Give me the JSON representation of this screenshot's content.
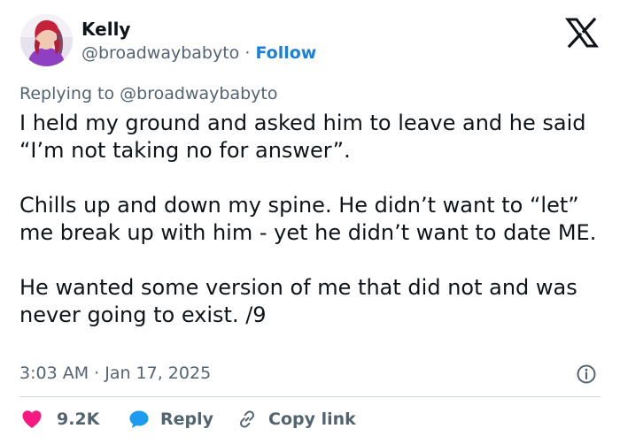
{
  "author": {
    "name": "Kelly",
    "handle": "@broadwaybabyto",
    "separator": "·",
    "follow_label": "Follow"
  },
  "reply_context": {
    "prefix": "Replying to",
    "handle": "@broadwaybabyto"
  },
  "tweet": {
    "paragraphs": [
      "I held my ground and asked him to leave and he said “I’m not taking no for answer”.",
      "Chills up and down my spine. He didn’t want to “let” me break up with him - yet he didn’t want to date ME.",
      "He wanted some version of me that did not and was never going to exist. /9"
    ],
    "timestamp": "3:03 AM · Jan 17, 2025"
  },
  "actions": {
    "likes_count": "9.2K",
    "reply_label": "Reply",
    "copy_link_label": "Copy link"
  },
  "icons": {
    "logo": "x-logo-icon",
    "info": "info-icon",
    "like": "heart-icon",
    "reply": "speech-bubble-icon",
    "copy": "link-icon"
  },
  "colors": {
    "text": "#0f1419",
    "secondary_text": "#536471",
    "follow": "#1d7fd9",
    "heart": "#f91880",
    "reply_bubble": "#1d9bf0",
    "divider": "#cfd9de"
  }
}
